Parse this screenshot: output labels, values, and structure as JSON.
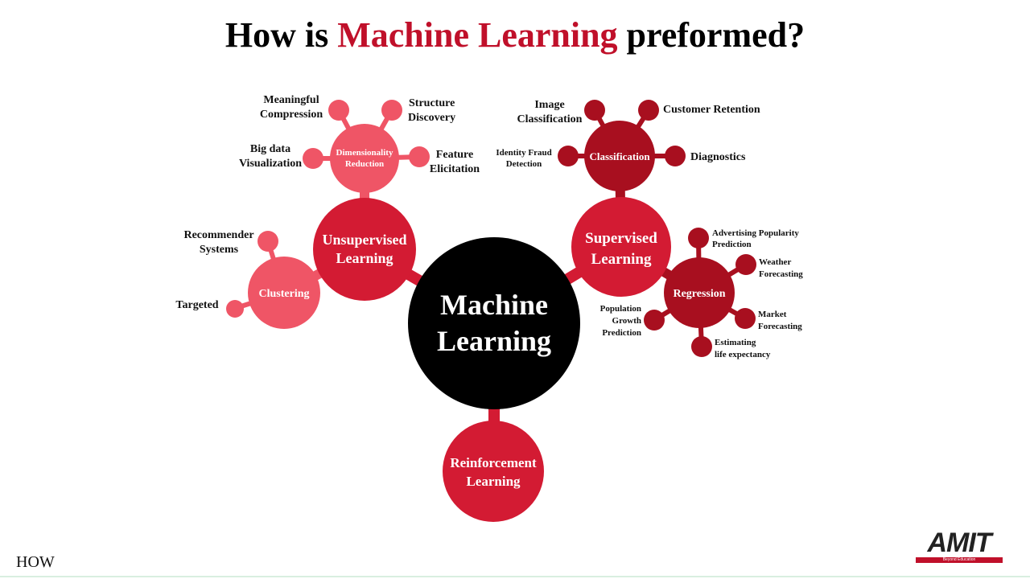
{
  "title": {
    "prefix": "How is ",
    "accent": "Machine Learning",
    "suffix": " preformed?"
  },
  "colors": {
    "dark_red": "#a80f1f",
    "mid_red": "#d31b33",
    "pink": "#ef5566",
    "black": "#000000"
  },
  "center": {
    "line1": "Machine",
    "line2": "Learning"
  },
  "branches": {
    "unsupervised": {
      "line1": "Unsupervised",
      "line2": "Learning"
    },
    "supervised": {
      "line1": "Supervised",
      "line2": "Learning"
    },
    "reinforcement": {
      "line1": "Reinforcement",
      "line2": "Learning"
    }
  },
  "sub_nodes": {
    "dimensionality": {
      "line1": "Dimensionality",
      "line2": "Reduction"
    },
    "clustering": {
      "line1": "Clustering"
    },
    "classification": {
      "line1": "Classification"
    },
    "regression": {
      "line1": "Regression"
    }
  },
  "leaves": {
    "meaningful_compression": {
      "line1": "Meaningful",
      "line2": "Compression"
    },
    "structure_discovery": {
      "line1": "Structure",
      "line2": "Discovery"
    },
    "big_data_visualization": {
      "line1": "Big data",
      "line2": "Visualization"
    },
    "feature_elicitation": {
      "line1": "Feature",
      "line2": "Elicitation"
    },
    "recommender_systems": {
      "line1": "Recommender",
      "line2": "Systems"
    },
    "targeted": {
      "line1": "Targeted"
    },
    "image_classification": {
      "line1": "Image",
      "line2": "Classification"
    },
    "customer_retention": {
      "line1": "Customer Retention"
    },
    "identity_fraud_detection": {
      "line1": "Identity Fraud",
      "line2": "Detection"
    },
    "diagnostics": {
      "line1": "Diagnostics"
    },
    "advertising_popularity": {
      "line1": "Advertising Popularity",
      "line2": "Prediction"
    },
    "weather_forecasting": {
      "line1": "Weather",
      "line2": "Forecasting"
    },
    "population_growth": {
      "line1": "Population",
      "line2": "Growth",
      "line3": "Prediction"
    },
    "market_forecasting": {
      "line1": "Market",
      "line2": "Forecasting"
    },
    "life_expectancy": {
      "line1": "Estimating",
      "line2": "life expectancy"
    }
  },
  "footer": {
    "text": "HOW"
  },
  "logo": {
    "text": "AMIT",
    "tagline": "Beyond Education"
  }
}
